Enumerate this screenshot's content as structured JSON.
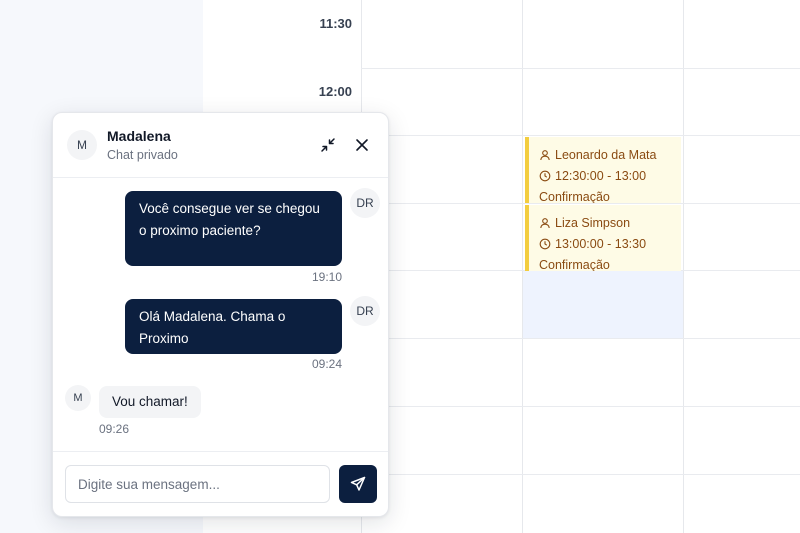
{
  "calendar": {
    "times": [
      "11:30",
      "12:00"
    ],
    "events": [
      {
        "patient": "Leonardo da Mata",
        "time": "12:30:00 - 13:00",
        "status": "Confirmação"
      },
      {
        "patient": "Liza Simpson",
        "time": "13:00:00 - 13:30",
        "status": "Confirmação"
      }
    ],
    "colors": {
      "event_bg": "#fefbe6",
      "event_border": "#f3cd3f",
      "event_text": "#8a4b12",
      "selected_slot": "#eef3fe"
    }
  },
  "chat": {
    "header": {
      "avatar": "M",
      "name": "Madalena",
      "subtitle": "Chat privado",
      "icons": [
        "minimize-icon",
        "close-icon"
      ]
    },
    "messages": [
      {
        "from": "out",
        "avatar": "DR",
        "text": "Você consegue ver se chegou o proximo paciente?",
        "time": "19:10"
      },
      {
        "from": "out",
        "avatar": "DR",
        "text": "Olá Madalena. Chama o Proximo",
        "time": "09:24"
      },
      {
        "from": "in",
        "avatar": "M",
        "text": "Vou chamar!",
        "time": "09:26"
      }
    ],
    "input": {
      "placeholder": "Digite sua mensagem...",
      "value": ""
    },
    "send_icon": "send-icon",
    "colors": {
      "accent": "#0c1f3f"
    }
  }
}
